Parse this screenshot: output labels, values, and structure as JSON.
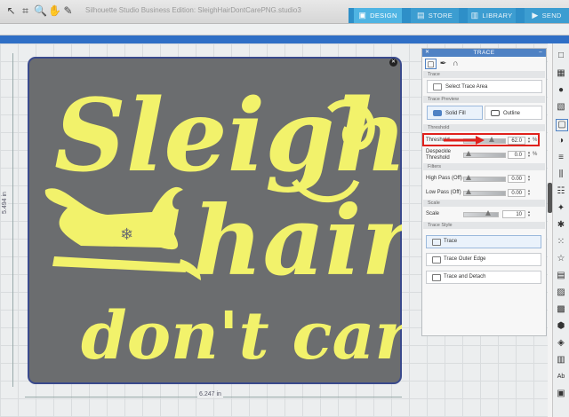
{
  "window_title": "Silhouette Studio Business Edition: SleighHairDontCarePNG.studio3",
  "nav": {
    "design": "DESIGN",
    "store": "STORE",
    "library": "LIBRARY",
    "send": "SEND"
  },
  "canvas": {
    "width_dim": "6.247 in",
    "height_dim": "5.494 in",
    "artboard_color": "#6b6d6f",
    "art_color": "#f2f26b"
  },
  "design_text": {
    "line1": "Sleigh",
    "line2": "hair",
    "line3": "don't care!"
  },
  "trace_panel": {
    "title": "TRACE",
    "sections": {
      "trace": "Trace",
      "preview": "Trace Preview",
      "threshold": "Threshold",
      "filters": "Filters",
      "scale": "Scale",
      "style": "Trace Style"
    },
    "select_trace_area": "Select Trace Area",
    "solid_fill": "Solid Fill",
    "outline": "Outline",
    "threshold_label": "Threshold",
    "threshold_value": "62.0",
    "threshold_unit": "%",
    "despeckle_label_1": "Despeckle",
    "despeckle_label_2": "Threshold",
    "despeckle_value": "0.0",
    "despeckle_unit": "%",
    "high_pass_label": "High Pass (Off)",
    "high_pass_value": "0.00",
    "low_pass_label": "Low Pass (Off)",
    "low_pass_value": "0.00",
    "scale_label": "Scale",
    "scale_value": "10",
    "trace_button": "Trace",
    "trace_outer_edge": "Trace Outer Edge",
    "trace_and_detach": "Trace and Detach"
  },
  "colors": {
    "accent": "#4fb4e3",
    "highlight": "#e0211c",
    "panel_header": "#4f82c4"
  }
}
